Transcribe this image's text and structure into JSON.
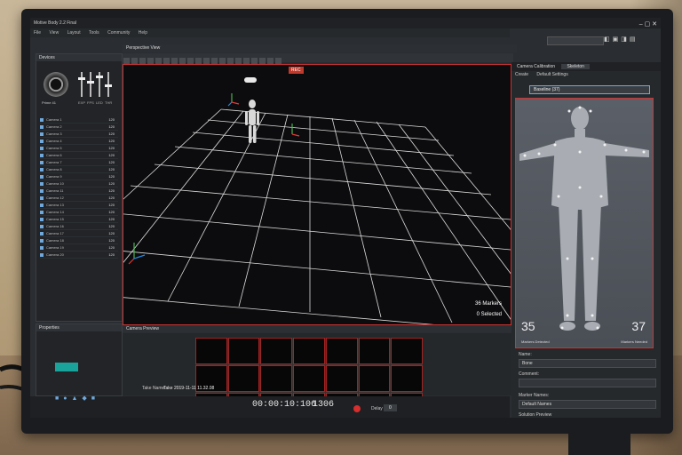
{
  "window": {
    "title": "Motive Body 2.2 Final",
    "controls": "–  ▢  ✕"
  },
  "menu": [
    "File",
    "View",
    "Layout",
    "Tools",
    "Community",
    "Help"
  ],
  "devices": {
    "title": "Devices",
    "sliders": [
      "EXP",
      "FPS",
      "LED",
      "THR"
    ],
    "camera_label": "Prime 41",
    "rows": [
      {
        "name": "Camera 1",
        "val": "120"
      },
      {
        "name": "Camera 2",
        "val": "120"
      },
      {
        "name": "Camera 3",
        "val": "120"
      },
      {
        "name": "Camera 4",
        "val": "120"
      },
      {
        "name": "Camera 5",
        "val": "120"
      },
      {
        "name": "Camera 6",
        "val": "120"
      },
      {
        "name": "Camera 7",
        "val": "120"
      },
      {
        "name": "Camera 8",
        "val": "120"
      },
      {
        "name": "Camera 9",
        "val": "120"
      },
      {
        "name": "Camera 10",
        "val": "120"
      },
      {
        "name": "Camera 11",
        "val": "120"
      },
      {
        "name": "Camera 12",
        "val": "120"
      },
      {
        "name": "Camera 13",
        "val": "120"
      },
      {
        "name": "Camera 14",
        "val": "120"
      },
      {
        "name": "Camera 15",
        "val": "120"
      },
      {
        "name": "Camera 16",
        "val": "120"
      },
      {
        "name": "Camera 17",
        "val": "120"
      },
      {
        "name": "Camera 18",
        "val": "120"
      },
      {
        "name": "Camera 19",
        "val": "120"
      },
      {
        "name": "Camera 20",
        "val": "120"
      }
    ]
  },
  "perspective": {
    "title": "Perspective View",
    "rec": "REC",
    "markers": "36 Markers",
    "selected": "0 Selected"
  },
  "preview": {
    "title": "Camera Preview"
  },
  "properties": {
    "title": "Properties"
  },
  "status": {
    "take_label": "Take Name:",
    "take_value": "Take 2019-11-11 11.32.08",
    "timecode": "00:00:10:106",
    "frame": "1306",
    "delay_label": "Delay",
    "delay_value": "0"
  },
  "right": {
    "tabs": [
      "Camera Calibration",
      "Skeleton"
    ],
    "subtabs": [
      "Create",
      "Default Settings"
    ],
    "preset": "Baseline (37)",
    "markers_detected": "35",
    "markers_detected_label": "Markers Detected",
    "markers_needed": "37",
    "markers_needed_label": "Markers Needed",
    "name_label": "Name:",
    "name_value": "Bone",
    "comment_label": "Comment:",
    "marker_names_label": "Marker Names:",
    "marker_names_value": "Default Names",
    "bottom_label": "Solution Preview"
  },
  "colors": {
    "accent_red": "#c83232",
    "teal": "#1aa39a",
    "grid": "#e6e6e6"
  }
}
